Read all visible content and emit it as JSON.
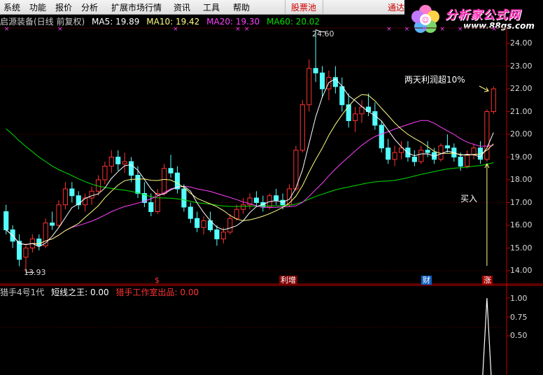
{
  "menu": {
    "items": [
      "系统",
      "功能",
      "报价",
      "分析",
      "扩展市场行情",
      "资讯",
      "工具",
      "帮助"
    ],
    "highlight": "股票池",
    "right_partial": "通达"
  },
  "logo": {
    "title": "分析家公式网",
    "url": "www.88gs.com"
  },
  "header": {
    "stock": "启源装备(日线 前复权)",
    "ma5": "MA5: 19.89",
    "ma10": "MA10: 19.42",
    "ma20": "MA20: 19.30",
    "ma60": "MA60: 20.02"
  },
  "price_axis": [
    "24.00",
    "23.00",
    "22.00",
    "21.00",
    "20.00",
    "19.00",
    "18.00",
    "17.00",
    "16.00",
    "15.00",
    "14.00"
  ],
  "markers": {
    "high": "24.60",
    "low": "13.93"
  },
  "annotations": {
    "gain": "两天利润超10%",
    "buy": "买入"
  },
  "events": [
    {
      "label": "$",
      "color": "#ff3333"
    },
    {
      "label": "利增",
      "color": "#ffffff",
      "bg": "#800000"
    },
    {
      "label": "财",
      "color": "#ffffff",
      "bg": "#1060c0"
    },
    {
      "label": "涨",
      "color": "#ffffff",
      "bg": "#a00000"
    }
  ],
  "indicator": {
    "name": "猎手4号1代",
    "line1": "短线之王: 0.00",
    "line2": "猎手工作室出品: 0.00",
    "axis": [
      "1.00",
      "0.75",
      "0.50"
    ]
  },
  "colors": {
    "up": "#ff3232",
    "down": "#54ffff",
    "ma5": "#ffffff",
    "ma10": "#ffff80",
    "ma20": "#ff40ff",
    "ma60": "#00e000",
    "axis": "#c00000"
  },
  "chart_data": {
    "type": "candlestick",
    "ylim": [
      13.6,
      24.6
    ],
    "ohlc": [
      [
        16.6,
        16.9,
        15.6,
        15.8
      ],
      [
        15.8,
        16.0,
        15.0,
        15.3
      ],
      [
        15.3,
        15.6,
        14.2,
        14.5
      ],
      [
        14.6,
        15.2,
        13.93,
        15.0
      ],
      [
        15.0,
        15.6,
        14.8,
        15.4
      ],
      [
        15.4,
        15.6,
        14.9,
        15.1
      ],
      [
        15.1,
        16.3,
        15.0,
        16.1
      ],
      [
        16.1,
        16.6,
        15.8,
        16.0
      ],
      [
        16.0,
        17.1,
        15.9,
        16.9
      ],
      [
        16.9,
        17.9,
        16.7,
        17.6
      ],
      [
        17.6,
        17.9,
        17.0,
        17.3
      ],
      [
        17.3,
        17.5,
        16.7,
        16.9
      ],
      [
        16.9,
        17.4,
        16.6,
        17.2
      ],
      [
        17.2,
        17.7,
        16.9,
        17.5
      ],
      [
        17.5,
        18.2,
        17.3,
        18.0
      ],
      [
        18.0,
        18.8,
        17.8,
        18.6
      ],
      [
        18.6,
        19.3,
        18.3,
        19.0
      ],
      [
        19.0,
        19.3,
        18.4,
        18.7
      ],
      [
        18.7,
        19.2,
        18.3,
        18.8
      ],
      [
        18.8,
        19.0,
        17.9,
        18.2
      ],
      [
        18.2,
        18.6,
        17.2,
        17.4
      ],
      [
        17.4,
        17.9,
        16.8,
        17.0
      ],
      [
        17.0,
        17.4,
        16.4,
        16.6
      ],
      [
        16.6,
        17.6,
        16.5,
        17.4
      ],
      [
        17.4,
        18.7,
        17.3,
        18.5
      ],
      [
        18.5,
        19.1,
        18.1,
        18.3
      ],
      [
        18.3,
        18.6,
        17.4,
        17.6
      ],
      [
        17.6,
        17.8,
        16.6,
        16.8
      ],
      [
        16.8,
        17.0,
        16.1,
        16.3
      ],
      [
        16.3,
        16.6,
        15.7,
        15.9
      ],
      [
        15.9,
        16.4,
        15.6,
        16.2
      ],
      [
        16.2,
        16.6,
        15.7,
        15.8
      ],
      [
        15.8,
        16.0,
        15.1,
        15.4
      ],
      [
        15.4,
        15.9,
        15.2,
        15.7
      ],
      [
        15.7,
        16.5,
        15.6,
        16.3
      ],
      [
        16.3,
        16.9,
        16.2,
        16.7
      ],
      [
        16.7,
        17.2,
        16.5,
        16.9
      ],
      [
        16.9,
        17.4,
        16.7,
        17.2
      ],
      [
        17.2,
        17.5,
        16.8,
        17.0
      ],
      [
        17.0,
        17.3,
        16.6,
        16.8
      ],
      [
        16.8,
        17.4,
        16.7,
        17.3
      ],
      [
        17.3,
        17.6,
        16.9,
        17.1
      ],
      [
        17.1,
        17.4,
        16.7,
        16.9
      ],
      [
        16.9,
        17.8,
        16.8,
        17.6
      ],
      [
        17.6,
        19.5,
        17.5,
        19.3
      ],
      [
        19.3,
        21.5,
        19.2,
        21.3
      ],
      [
        21.3,
        23.3,
        21.0,
        22.9
      ],
      [
        22.9,
        24.6,
        22.3,
        22.7
      ],
      [
        22.7,
        23.0,
        21.6,
        22.0
      ],
      [
        22.0,
        22.8,
        21.5,
        22.5
      ],
      [
        22.5,
        23.0,
        21.8,
        22.1
      ],
      [
        22.1,
        22.5,
        21.0,
        21.3
      ],
      [
        21.3,
        21.8,
        20.3,
        20.6
      ],
      [
        20.6,
        21.2,
        20.1,
        20.9
      ],
      [
        20.9,
        21.5,
        20.5,
        21.2
      ],
      [
        21.2,
        21.8,
        20.8,
        21.0
      ],
      [
        21.0,
        21.4,
        20.2,
        20.4
      ],
      [
        20.4,
        20.6,
        19.2,
        19.4
      ],
      [
        19.4,
        19.8,
        18.7,
        18.9
      ],
      [
        18.9,
        19.5,
        18.6,
        19.2
      ],
      [
        19.2,
        19.7,
        18.9,
        19.4
      ],
      [
        19.4,
        19.7,
        18.8,
        19.0
      ],
      [
        19.0,
        19.3,
        18.6,
        18.8
      ],
      [
        18.8,
        19.5,
        18.7,
        19.3
      ],
      [
        19.3,
        19.7,
        19.0,
        19.2
      ],
      [
        19.2,
        19.4,
        18.7,
        18.9
      ],
      [
        18.9,
        19.6,
        18.8,
        19.5
      ],
      [
        19.5,
        20.0,
        19.2,
        19.4
      ],
      [
        19.4,
        19.6,
        18.8,
        19.0
      ],
      [
        19.0,
        19.2,
        18.4,
        18.6
      ],
      [
        18.6,
        19.3,
        18.5,
        19.1
      ],
      [
        19.1,
        19.6,
        18.9,
        19.4
      ],
      [
        19.4,
        19.7,
        18.7,
        18.9
      ],
      [
        18.9,
        21.1,
        18.8,
        21.0
      ],
      [
        21.0,
        22.1,
        20.9,
        22.0
      ]
    ],
    "buy_signal_index": 73
  }
}
